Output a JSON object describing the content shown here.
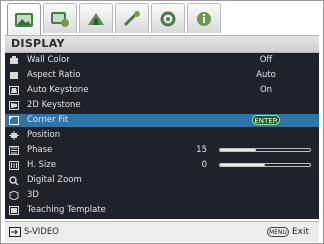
{
  "tabs": [
    {
      "icon": "picture-icon",
      "active": true
    },
    {
      "icon": "advanced-picture-icon",
      "active": false
    },
    {
      "icon": "settings-icon",
      "active": false
    },
    {
      "icon": "advanced-settings-icon",
      "active": false
    },
    {
      "icon": "system-setup-icon",
      "active": false
    },
    {
      "icon": "information-icon",
      "active": false
    }
  ],
  "header": {
    "title": "DISPLAY"
  },
  "menu": {
    "items": [
      {
        "icon": "wall-color-icon",
        "label": "Wall Color",
        "value": "Off"
      },
      {
        "icon": "aspect-ratio-icon",
        "label": "Aspect Ratio",
        "value": "Auto"
      },
      {
        "icon": "auto-keystone-icon",
        "label": "Auto Keystone",
        "value": "On"
      },
      {
        "icon": "keystone-2d-icon",
        "label": "2D Keystone",
        "value": ""
      },
      {
        "icon": "corner-fit-icon",
        "label": "Corner Fit",
        "value": "ENTER",
        "selected": true
      },
      {
        "icon": "position-icon",
        "label": "Position",
        "value": ""
      },
      {
        "icon": "phase-icon",
        "label": "Phase",
        "number": "15",
        "level": 0.4
      },
      {
        "icon": "h-size-icon",
        "label": "H. Size",
        "number": "0",
        "level": 0.5
      },
      {
        "icon": "digital-zoom-icon",
        "label": "Digital Zoom",
        "value": ""
      },
      {
        "icon": "3d-icon",
        "label": "3D",
        "value": ""
      },
      {
        "icon": "teaching-template-icon",
        "label": "Teaching Template",
        "value": ""
      }
    ]
  },
  "footer": {
    "source": "S-VIDEO",
    "menu_key": "MENU",
    "exit": "Exit"
  },
  "colors": {
    "menu_bg": "#1f2229",
    "selected": "#2f74a8",
    "enter_bg": "#1b5a21"
  }
}
